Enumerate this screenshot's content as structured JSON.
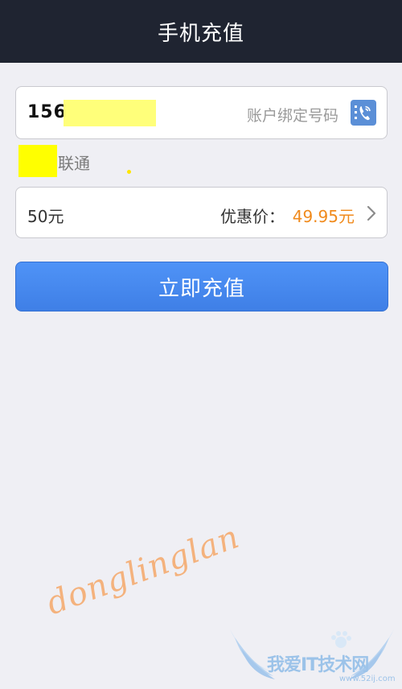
{
  "header": {
    "title": "手机充值"
  },
  "phone": {
    "number_prefix": "156",
    "hint": "账户绑定号码",
    "contact_icon": "contact-phone-icon"
  },
  "carrier": {
    "name": "联通"
  },
  "amount": {
    "value": "50元",
    "price_label": "优惠价：",
    "price_value": "49.95元",
    "arrow_icon": "chevron-right-icon"
  },
  "action": {
    "charge_label": "立即充值"
  },
  "watermarks": {
    "signature": "donglinglan",
    "site_name": "我爱IT技术网",
    "site_domain": "www.52ij.com"
  },
  "colors": {
    "titlebar": "#1f2431",
    "accent_blue": "#4a8af2",
    "price_orange": "#f08a1c"
  }
}
